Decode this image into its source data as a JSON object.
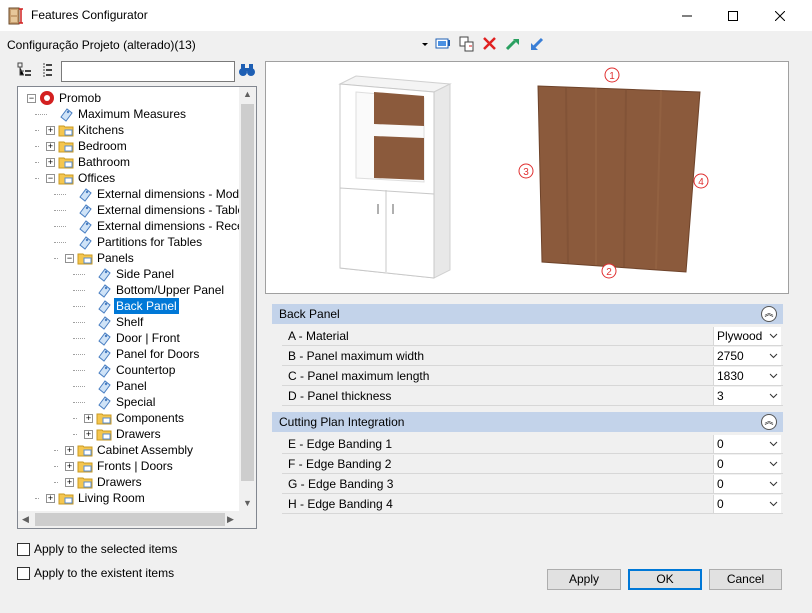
{
  "window": {
    "title": "Features Configurator",
    "icon": "app-icon",
    "controls": [
      "minimize-icon",
      "maximize-icon",
      "close-icon"
    ]
  },
  "toolbar": {
    "config_label": "Configuração Projeto (alterado)(13)",
    "icons": [
      "dropdown-arrow-icon",
      "screen-icon",
      "copy-icon",
      "delete-icon",
      "export-icon",
      "import-icon"
    ]
  },
  "tree_tools": {
    "icons": [
      "expand-tree-icon",
      "collapse-tree-icon",
      "binoculars-icon"
    ],
    "search_value": ""
  },
  "tree": {
    "items": [
      {
        "label": "Promob",
        "level": 0,
        "type": "root",
        "expander": "-"
      },
      {
        "label": "Maximum Measures",
        "level": 1,
        "type": "feature"
      },
      {
        "label": "Kitchens",
        "level": 1,
        "type": "folder",
        "expander": "+"
      },
      {
        "label": "Bedroom",
        "level": 1,
        "type": "folder",
        "expander": "+"
      },
      {
        "label": "Bathroom",
        "level": 1,
        "type": "folder",
        "expander": "+"
      },
      {
        "label": "Offices",
        "level": 1,
        "type": "folder",
        "expander": "-"
      },
      {
        "label": "External dimensions - Modules",
        "level": 2,
        "type": "feature"
      },
      {
        "label": "External dimensions - Tables",
        "level": 2,
        "type": "feature"
      },
      {
        "label": "External dimensions - Receptions",
        "level": 2,
        "type": "feature"
      },
      {
        "label": "Partitions for Tables",
        "level": 2,
        "type": "feature"
      },
      {
        "label": "Panels",
        "level": 2,
        "type": "folder",
        "expander": "-"
      },
      {
        "label": "Side Panel",
        "level": 3,
        "type": "feature"
      },
      {
        "label": "Bottom/Upper Panel",
        "level": 3,
        "type": "feature"
      },
      {
        "label": "Back Panel",
        "level": 3,
        "type": "feature",
        "selected": true
      },
      {
        "label": "Shelf",
        "level": 3,
        "type": "feature"
      },
      {
        "label": "Door | Front",
        "level": 3,
        "type": "feature"
      },
      {
        "label": "Panel for Doors",
        "level": 3,
        "type": "feature"
      },
      {
        "label": "Countertop",
        "level": 3,
        "type": "feature"
      },
      {
        "label": "Panel",
        "level": 3,
        "type": "feature"
      },
      {
        "label": "Special",
        "level": 3,
        "type": "feature"
      },
      {
        "label": "Components",
        "level": 3,
        "type": "folder",
        "expander": "+"
      },
      {
        "label": "Drawers",
        "level": 3,
        "type": "folder",
        "expander": "+"
      },
      {
        "label": "Cabinet Assembly",
        "level": 2,
        "type": "folder",
        "expander": "+"
      },
      {
        "label": "Fronts | Doors",
        "level": 2,
        "type": "folder",
        "expander": "+"
      },
      {
        "label": "Drawers",
        "level": 2,
        "type": "folder",
        "expander": "+"
      },
      {
        "label": "Living Room",
        "level": 1,
        "type": "folder",
        "expander": "+"
      }
    ]
  },
  "preview": {
    "edge_markers": [
      "1",
      "2",
      "3",
      "4"
    ],
    "wood_color": "#8b5a3c"
  },
  "properties": {
    "sections": [
      {
        "title": "Back Panel",
        "rows": [
          {
            "key": "A - Material",
            "value": "Plywood"
          },
          {
            "key": "B - Panel maximum width",
            "value": "2750"
          },
          {
            "key": "C - Panel maximum length",
            "value": "1830"
          },
          {
            "key": "D - Panel thickness",
            "value": "3"
          }
        ]
      },
      {
        "title": "Cutting Plan Integration",
        "rows": [
          {
            "key": "E - Edge Banding 1",
            "value": "0"
          },
          {
            "key": "F - Edge Banding 2",
            "value": "0"
          },
          {
            "key": "G - Edge Banding 3",
            "value": "0"
          },
          {
            "key": "H - Edge Banding 4",
            "value": "0"
          }
        ]
      }
    ]
  },
  "options": {
    "apply_selected": "Apply to the selected items",
    "apply_existent": "Apply to the existent items"
  },
  "buttons": {
    "apply": "Apply",
    "ok": "OK",
    "cancel": "Cancel"
  },
  "colors": {
    "selection": "#0078d7",
    "section_header": "#c3d3ea",
    "marker_red": "#e03030"
  }
}
